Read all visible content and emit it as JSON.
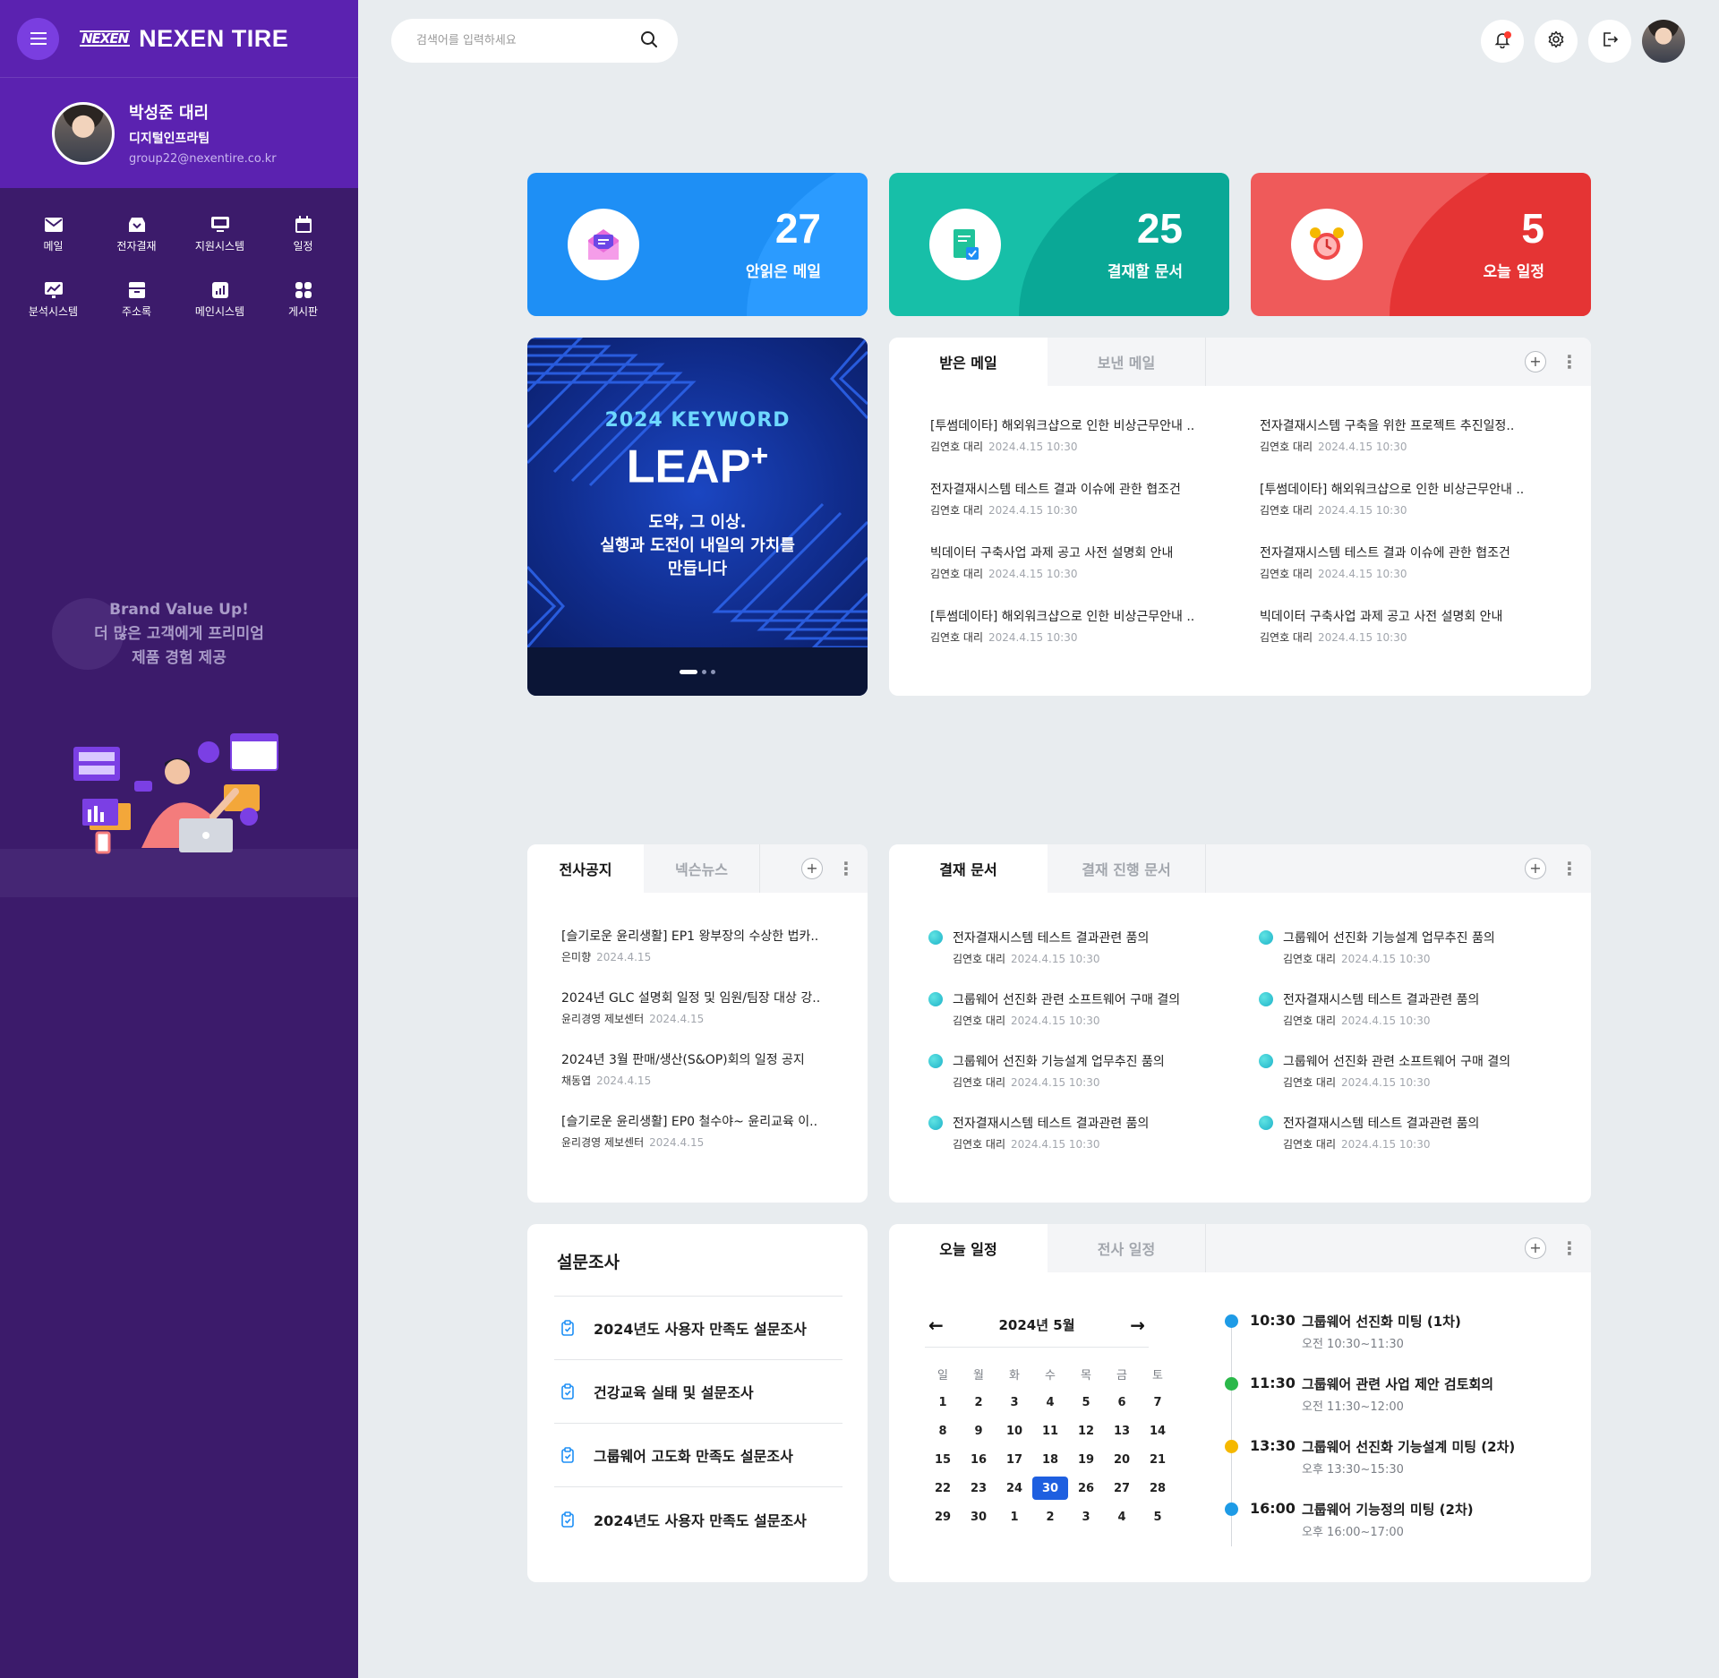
{
  "brand": {
    "logo_mark": "NEXEN",
    "logo_text": "NEXEN TIRE"
  },
  "profile": {
    "name": "박성준 대리",
    "dept": "디지털인프라팀",
    "email": "group22@nexentire.co.kr"
  },
  "quick_menu": [
    {
      "label": "메일",
      "icon": "mail-icon"
    },
    {
      "label": "전자결재",
      "icon": "approval-inbox-icon"
    },
    {
      "label": "지원시스템",
      "icon": "monitor-icon"
    },
    {
      "label": "일정",
      "icon": "calendar-icon"
    },
    {
      "label": "분석시스템",
      "icon": "analytics-icon"
    },
    {
      "label": "주소록",
      "icon": "address-book-icon"
    },
    {
      "label": "메인시스템",
      "icon": "main-system-icon"
    },
    {
      "label": "게시판",
      "icon": "board-grid-icon"
    }
  ],
  "sidebar_promo": {
    "line1": "Brand Value Up!",
    "line2": "더 많은 고객에게 프리미엄",
    "line3": "제품 경험 제공"
  },
  "search": {
    "placeholder": "검색어를 입력하세요"
  },
  "stats": [
    {
      "value": "27",
      "label": "안읽은 메일",
      "color": "#1e8ff5",
      "icon": "mail-open-icon"
    },
    {
      "value": "25",
      "label": "결재할 문서",
      "color": "#17bfa8",
      "icon": "document-check-icon"
    },
    {
      "value": "5",
      "label": "오늘 일정",
      "color": "#ec4b4b",
      "icon": "alarm-clock-icon"
    }
  ],
  "banner": {
    "keyword": "2024 KEYWORD",
    "title": "LEAP",
    "title_sup": "+",
    "line1": "도약, 그 이상.",
    "line2": "실행과 도전이 내일의 가치를",
    "line3": "만듭니다"
  },
  "mail": {
    "tabs": [
      "받은 메일",
      "보낸 메일"
    ],
    "items": [
      {
        "title": "[투썸데이타] 해외워크샵으로 인한 비상근무안내 ..",
        "author": "김연호 대리",
        "date": "2024.4.15 10:30"
      },
      {
        "title": "전자결재시스템 구축을 위한 프로젝트 추진일정..",
        "author": "김연호 대리",
        "date": "2024.4.15 10:30"
      },
      {
        "title": "전자결재시스템 테스트 결과 이슈에 관한 협조건",
        "author": "김연호 대리",
        "date": "2024.4.15 10:30"
      },
      {
        "title": "[투썸데이타] 해외워크샵으로 인한 비상근무안내 ..",
        "author": "김연호 대리",
        "date": "2024.4.15 10:30"
      },
      {
        "title": "빅데이터 구축사업 과제 공고 사전 설명회 안내",
        "author": "김연호 대리",
        "date": "2024.4.15 10:30"
      },
      {
        "title": "전자결재시스템 테스트 결과 이슈에 관한 협조건",
        "author": "김연호 대리",
        "date": "2024.4.15 10:30"
      },
      {
        "title": "[투썸데이타] 해외워크샵으로 인한 비상근무안내 ..",
        "author": "김연호 대리",
        "date": "2024.4.15 10:30"
      },
      {
        "title": "빅데이터 구축사업 과제 공고 사전 설명회 안내",
        "author": "김연호 대리",
        "date": "2024.4.15 10:30"
      }
    ]
  },
  "notice": {
    "tabs": [
      "전사공지",
      "넥슨뉴스"
    ],
    "items": [
      {
        "title": "[슬기로운 윤리생활] EP1 왕부장의 수상한 법카..",
        "author": "은미향",
        "date": "2024.4.15"
      },
      {
        "title": "2024년 GLC 설명회 일정 및 임원/팀장 대상 강..",
        "author": "윤리경영 제보센터",
        "date": "2024.4.15"
      },
      {
        "title": "2024년 3월 판매/생산(S&OP)회의 일정 공지",
        "author": "채동엽",
        "date": "2024.4.15"
      },
      {
        "title": "[슬기로운 윤리생활] EP0 철수야~ 윤리교육 이..",
        "author": "윤리경영 제보센터",
        "date": "2024.4.15"
      }
    ]
  },
  "approval": {
    "tabs": [
      "결재 문서",
      "결재 진행 문서"
    ],
    "items": [
      {
        "title": "전자결재시스템 테스트 결과관련 품의",
        "author": "김연호 대리",
        "date": "2024.4.15 10:30"
      },
      {
        "title": "그룹웨어 선진화 기능설계 업무추진 품의",
        "author": "김연호 대리",
        "date": "2024.4.15 10:30"
      },
      {
        "title": "그룹웨어 선진화 관련 소프트웨어 구매 결의",
        "author": "김연호 대리",
        "date": "2024.4.15 10:30"
      },
      {
        "title": "전자결재시스템 테스트 결과관련 품의",
        "author": "김연호 대리",
        "date": "2024.4.15 10:30"
      },
      {
        "title": "그룹웨어 선진화 기능설계 업무추진 품의",
        "author": "김연호 대리",
        "date": "2024.4.15 10:30"
      },
      {
        "title": "그룹웨어 선진화 관련 소프트웨어 구매 결의",
        "author": "김연호 대리",
        "date": "2024.4.15 10:30"
      },
      {
        "title": "전자결재시스템 테스트 결과관련 품의",
        "author": "김연호 대리",
        "date": "2024.4.15 10:30"
      },
      {
        "title": "전자결재시스템 테스트 결과관련 품의",
        "author": "김연호 대리",
        "date": "2024.4.15 10:30"
      }
    ]
  },
  "survey": {
    "title": "설문조사",
    "items": [
      "2024년도 사용자 만족도 설문조사",
      "건강교육 실태 및 설문조사",
      "그룹웨어 고도화 만족도 설문조사",
      "2024년도 사용자 만족도 설문조사"
    ]
  },
  "schedule": {
    "tabs": [
      "오늘 일정",
      "전사 일정"
    ],
    "month_title": "2024년 5월",
    "dow": [
      "일",
      "월",
      "화",
      "수",
      "목",
      "금",
      "토"
    ],
    "days": [
      "1",
      "2",
      "3",
      "4",
      "5",
      "6",
      "7",
      "8",
      "9",
      "10",
      "11",
      "12",
      "13",
      "14",
      "15",
      "16",
      "17",
      "18",
      "19",
      "20",
      "21",
      "22",
      "23",
      "24",
      "30",
      "26",
      "27",
      "28",
      "29",
      "30",
      "1",
      "2",
      "3",
      "4",
      "5"
    ],
    "selected_index": 24,
    "events": [
      {
        "time": "10:30",
        "title": "그룹웨어 선진화 미팅 (1차)",
        "range": "오전 10:30~11:30",
        "color": "#1e9be6"
      },
      {
        "time": "11:30",
        "title": "그룹웨어 관련 사업 제안 검토회의",
        "range": "오전 11:30~12:00",
        "color": "#2bb84a"
      },
      {
        "time": "13:30",
        "title": "그룹웨어 선진화 기능설계 미팅 (2차)",
        "range": "오후 13:30~15:30",
        "color": "#f5b800"
      },
      {
        "time": "16:00",
        "title": "그룹웨어 기능정의 미팅 (2차)",
        "range": "오후 16:00~17:00",
        "color": "#1e9be6"
      }
    ]
  }
}
